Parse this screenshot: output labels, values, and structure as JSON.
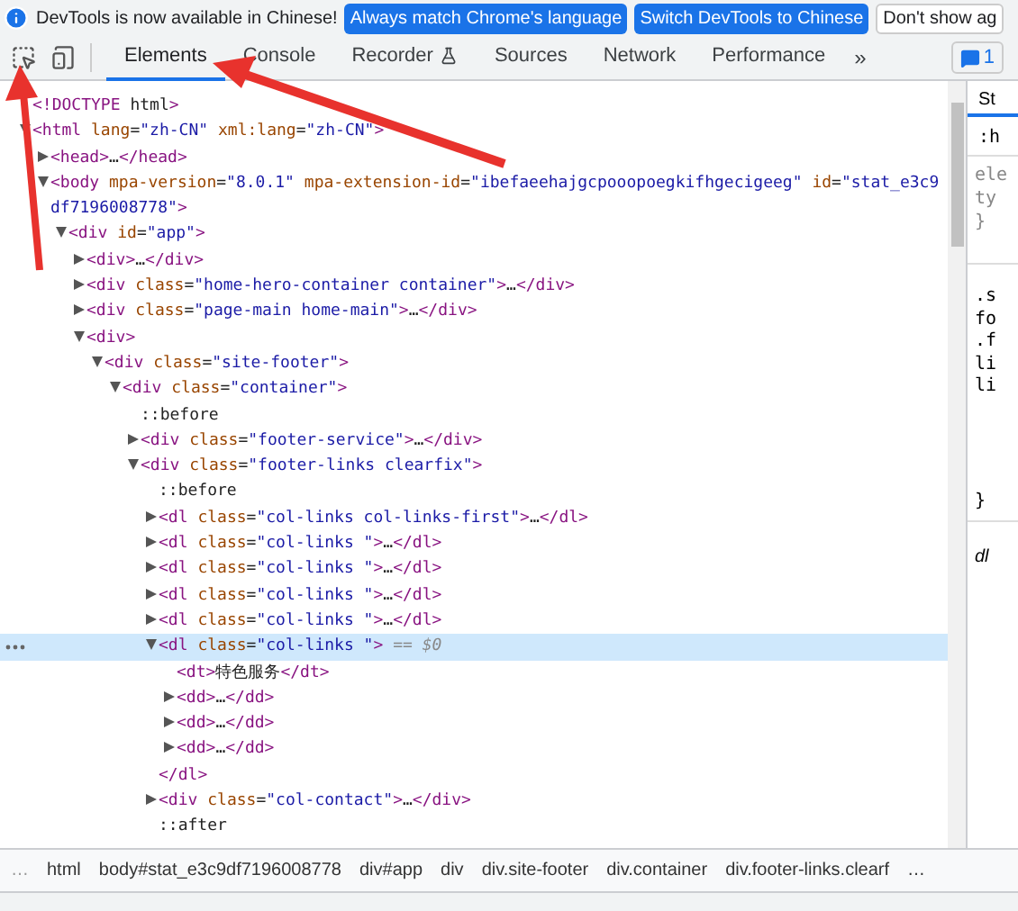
{
  "infobar": {
    "message": "DevTools is now available in Chinese!",
    "buttons": [
      "Always match Chrome's language",
      "Switch DevTools to Chinese"
    ],
    "dismiss": "Don't show ag"
  },
  "toolbar": {
    "tabs": [
      {
        "label": "Elements",
        "selected": true,
        "kind": "plain"
      },
      {
        "label": "Console",
        "selected": false,
        "kind": "plain"
      },
      {
        "label": "Recorder",
        "selected": false,
        "kind": "experimental"
      },
      {
        "label": "Sources",
        "selected": false,
        "kind": "plain"
      },
      {
        "label": "Network",
        "selected": false,
        "kind": "plain"
      },
      {
        "label": "Performance",
        "selected": false,
        "kind": "plain"
      }
    ],
    "more": "»",
    "issues": "1"
  },
  "tree": [
    {
      "text": "<!DOCTYPE html>",
      "selected": false
    },
    {
      "text": "<html lang=\"zh-CN\" xml:lang=\"zh-CN\">",
      "selected": false,
      "expanded": true,
      "children": [
        {
          "text": "<head>…</head>",
          "selected": false,
          "expanded": false
        },
        {
          "text": "<body mpa-version=\"8.0.1\" mpa-extension-id=\"ibefaeehajgcpooopoegkifhgecigeeg\" id=\"stat_e3c9df7196008778\">",
          "selected": false,
          "expanded": true,
          "children": [
            {
              "text": "<div id=\"app\">",
              "selected": false,
              "expanded": true,
              "children": [
                {
                  "text": "<div>…</div>",
                  "selected": false,
                  "expanded": false
                },
                {
                  "text": "<div class=\"home-hero-container container\">…</div>",
                  "selected": false,
                  "expanded": false
                },
                {
                  "text": "<div class=\"page-main home-main\">…</div>",
                  "selected": false,
                  "expanded": false
                },
                {
                  "text": "<div>",
                  "selected": false,
                  "expanded": true,
                  "children": [
                    {
                      "text": "<div class=\"site-footer\">",
                      "selected": false,
                      "expanded": true,
                      "children": [
                        {
                          "text": "<div class=\"container\">",
                          "selected": false,
                          "expanded": true,
                          "children": [
                            {
                              "text": "::before",
                              "selected": false
                            },
                            {
                              "text": "<div class=\"footer-service\">…</div>",
                              "selected": false,
                              "expanded": false
                            },
                            {
                              "text": "<div class=\"footer-links clearfix\">",
                              "selected": false,
                              "expanded": true,
                              "children": [
                                {
                                  "text": "::before",
                                  "selected": false
                                },
                                {
                                  "text": "<dl class=\"col-links col-links-first\">…</dl>",
                                  "selected": false,
                                  "expanded": false
                                },
                                {
                                  "text": "<dl class=\"col-links \">…</dl>",
                                  "selected": false,
                                  "expanded": false
                                },
                                {
                                  "text": "<dl class=\"col-links \">…</dl>",
                                  "selected": false,
                                  "expanded": false
                                },
                                {
                                  "text": "<dl class=\"col-links \">…</dl>",
                                  "selected": false,
                                  "expanded": false
                                },
                                {
                                  "text": "<dl class=\"col-links \">…</dl>",
                                  "selected": false,
                                  "expanded": false
                                },
                                {
                                  "text": "<dl class=\"col-links \">",
                                  "marker": "== $0",
                                  "selected": true,
                                  "expanded": true,
                                  "closing": "</dl>",
                                  "children": [
                                    {
                                      "text": "<dt>特色服务</dt>",
                                      "selected": false
                                    },
                                    {
                                      "text": "<dd>…</dd>",
                                      "selected": false,
                                      "expanded": false
                                    },
                                    {
                                      "text": "<dd>…</dd>",
                                      "selected": false,
                                      "expanded": false
                                    },
                                    {
                                      "text": "<dd>…</dd>",
                                      "selected": false,
                                      "expanded": false
                                    }
                                  ]
                                },
                                {
                                  "text": "<div class=\"col-contact\">…</div>",
                                  "selected": false,
                                  "expanded": false
                                },
                                {
                                  "text": "::after",
                                  "selected": false
                                }
                              ]
                            }
                          ]
                        }
                      ]
                    }
                  ]
                }
              ]
            }
          ]
        }
      ]
    }
  ],
  "styles_panel": {
    "tab": "St",
    "filter": ":h",
    "lines": [
      "ele",
      "ty",
      "}"
    ],
    "rule_lines": [
      ".s",
      "fo",
      ".f",
      "li",
      "li",
      "}"
    ],
    "footer": "dl"
  },
  "breadcrumbs": {
    "leading": "…",
    "items": [
      "html",
      "body#stat_e3c9df7196008778",
      "div#app",
      "div",
      "div.site-footer",
      "div.container",
      "div.footer-links.clearf"
    ],
    "trailing": "…"
  }
}
